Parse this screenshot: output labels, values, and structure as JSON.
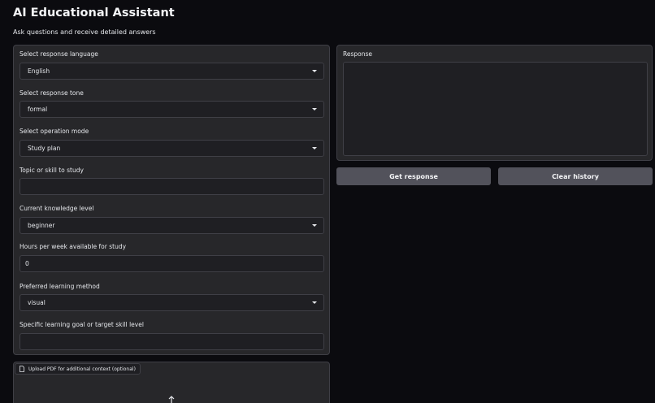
{
  "header": {
    "title": "AI Educational Assistant",
    "subtitle": "Ask questions and receive detailed answers"
  },
  "form": {
    "language": {
      "label": "Select response language",
      "value": "English"
    },
    "tone": {
      "label": "Select response tone",
      "value": "formal"
    },
    "mode": {
      "label": "Select operation mode",
      "value": "Study plan"
    },
    "topic": {
      "label": "Topic or skill to study",
      "value": ""
    },
    "knowledge": {
      "label": "Current knowledge level",
      "value": "beginner"
    },
    "hours": {
      "label": "Hours per week available for study",
      "value": "0"
    },
    "method": {
      "label": "Preferred learning method",
      "value": "visual"
    },
    "goal": {
      "label": "Specific learning goal or target skill level",
      "value": ""
    }
  },
  "response": {
    "label": "Response",
    "value": ""
  },
  "buttons": {
    "get": "Get response",
    "clear": "Clear history"
  },
  "upload": {
    "label": "Upload PDF for additional context (optional)"
  },
  "icons": {
    "dropdown": "chevron-down-icon",
    "file": "file-icon",
    "upload": "upload-icon"
  }
}
